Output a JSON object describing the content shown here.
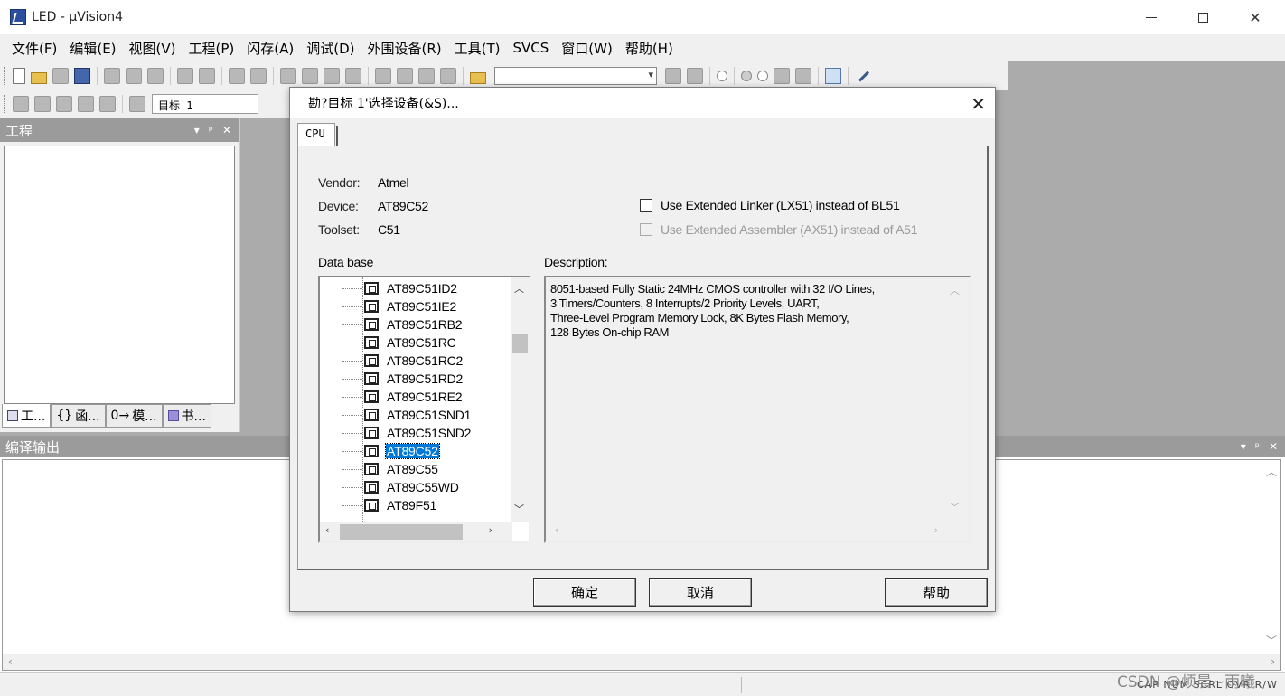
{
  "window": {
    "title": "LED  - µVision4",
    "minimize": "—",
    "close": "✕"
  },
  "menu": [
    "文件(F)",
    "编辑(E)",
    "视图(V)",
    "工程(P)",
    "闪存(A)",
    "调试(D)",
    "外围设备(R)",
    "工具(T)",
    "SVCS",
    "窗口(W)",
    "帮助(H)"
  ],
  "toolbar2": {
    "target": "目标 1"
  },
  "project_panel": {
    "title": "工程",
    "tabs": [
      "工...",
      "函...",
      "模...",
      "书..."
    ]
  },
  "output_panel": {
    "title": "编译输出"
  },
  "status": {
    "indicators": "CAP  NUM  SCRL  OVR  R/W"
  },
  "watermark": "CSDN @烦晨~雨曦",
  "dialog": {
    "title": "勘?目标 1'选择设备(&S)...",
    "close": "✕",
    "tab": "CPU",
    "vendor_label": "Vendor:",
    "vendor": "Atmel",
    "device_label": "Device:",
    "device": "AT89C52",
    "toolset_label": "Toolset:",
    "toolset": "C51",
    "checkbox_lx51": "Use Extended Linker (LX51) instead of BL51",
    "checkbox_ax51": "Use Extended Assembler (AX51) instead of A51",
    "database_label": "Data base",
    "description_label": "Description:",
    "devices": [
      "AT89C51ID2",
      "AT89C51IE2",
      "AT89C51RB2",
      "AT89C51RC",
      "AT89C51RC2",
      "AT89C51RD2",
      "AT89C51RE2",
      "AT89C51SND1",
      "AT89C51SND2",
      "AT89C52",
      "AT89C55",
      "AT89C55WD",
      "AT89F51"
    ],
    "selected_device": "AT89C52",
    "description_lines": [
      "8051-based Fully Static 24MHz CMOS controller with 32  I/O Lines,",
      "3 Timers/Counters, 8 Interrupts/2 Priority Levels, UART,",
      "Three-Level Program Memory Lock, 8K Bytes Flash Memory,",
      "128 Bytes On-chip RAM"
    ],
    "buttons": {
      "ok": "确定",
      "cancel": "取消",
      "help": "帮助"
    }
  }
}
